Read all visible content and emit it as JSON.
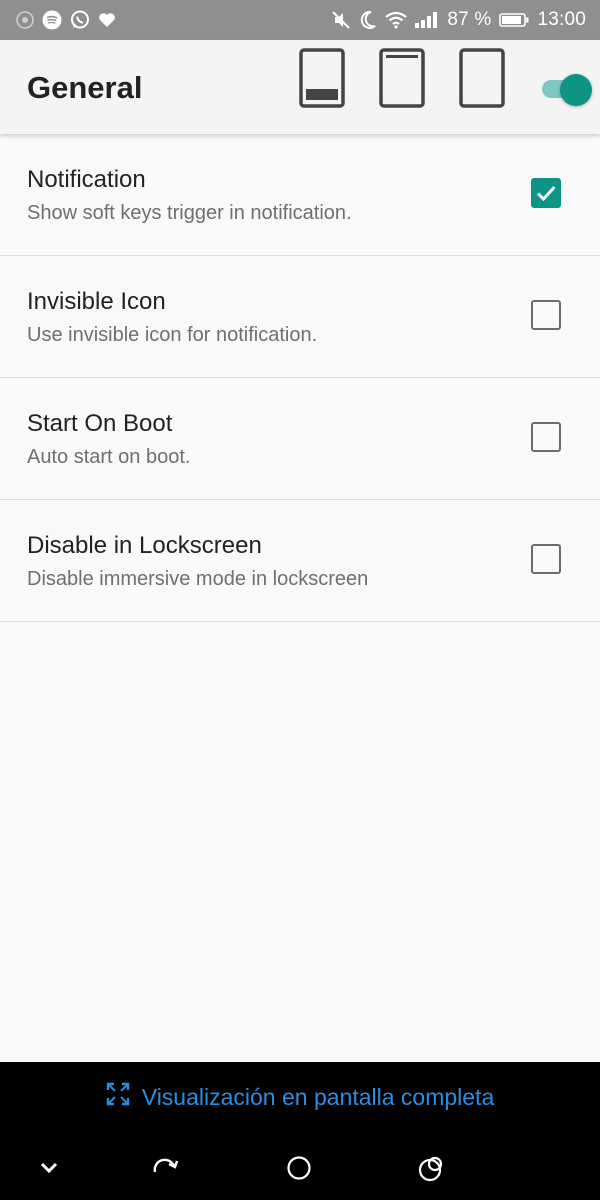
{
  "status_bar": {
    "left_icons": [
      "eye-icon",
      "spotify-icon",
      "whatsapp-icon",
      "heart-icon"
    ],
    "right_icons": [
      "mute-icon",
      "moon-icon",
      "wifi-icon",
      "signal-icon"
    ],
    "battery_percent": "87 %",
    "time": "13:00"
  },
  "app_bar": {
    "title": "General",
    "mode_icons": [
      "immersive-mode-nav-icon",
      "immersive-mode-status-icon",
      "immersive-mode-full-icon"
    ],
    "master_switch_on": true
  },
  "preferences": [
    {
      "title": "Notification",
      "summary": "Show soft keys trigger in notification.",
      "checked": true
    },
    {
      "title": "Invisible Icon",
      "summary": "Use invisible icon for notification.",
      "checked": false
    },
    {
      "title": "Start On Boot",
      "summary": "Auto start on boot.",
      "checked": false
    },
    {
      "title": "Disable in Lockscreen",
      "summary": "Disable immersive mode in lockscreen",
      "checked": false
    }
  ],
  "immersive_overlay": {
    "hint": "Visualización en pantalla completa",
    "nav_icons": [
      "chevron-down-icon",
      "rotate-icon",
      "home-circle-icon",
      "recents-icon"
    ]
  },
  "colors": {
    "accent": "#0e9485",
    "status_bar": "#8f8f8f",
    "hint_text": "#2a8de2"
  }
}
